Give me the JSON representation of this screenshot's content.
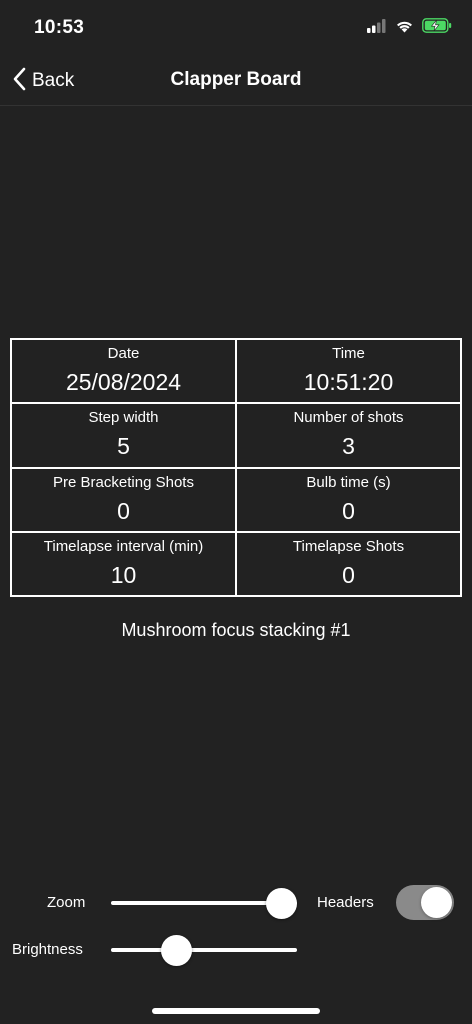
{
  "status_bar": {
    "time": "10:53",
    "icons": [
      "cellular-signal-icon",
      "wifi-icon",
      "battery-charging-icon"
    ],
    "battery_color": "#4cd964"
  },
  "nav": {
    "back_label": "Back",
    "title": "Clapper Board"
  },
  "grid": {
    "cells": [
      {
        "label": "Date",
        "value": "25/08/2024"
      },
      {
        "label": "Time",
        "value": "10:51:20"
      },
      {
        "label": "Step width",
        "value": "5"
      },
      {
        "label": "Number of shots",
        "value": "3"
      },
      {
        "label": "Pre Bracketing Shots",
        "value": "0"
      },
      {
        "label": "Bulb time (s)",
        "value": "0"
      },
      {
        "label": "Timelapse interval (min)",
        "value": "10"
      },
      {
        "label": "Timelapse Shots",
        "value": "0"
      }
    ]
  },
  "caption": "Mushroom focus stacking #1",
  "controls": {
    "zoom_label": "Zoom",
    "zoom_level": 1.0,
    "headers_label": "Headers",
    "headers_on": true,
    "brightness_label": "Brightness",
    "brightness_level": 0.35
  },
  "colors": {
    "background": "#222222",
    "foreground": "#ffffff",
    "toggle_track": "#8a8a8a"
  }
}
